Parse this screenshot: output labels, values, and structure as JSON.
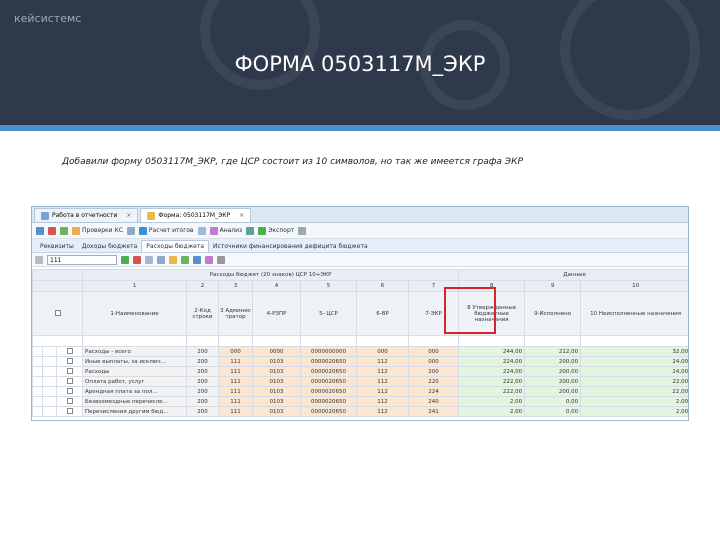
{
  "slide": {
    "logo": "кейсистемс",
    "title": "ФОРМА 0503117М_ЭКР",
    "caption": "Добавили форму 0503117М_ЭКР, где ЦСР состоит из 10 символов, но так же имеется графа ЭКР"
  },
  "app": {
    "tabs": [
      {
        "label": "Работа в отчетности",
        "close": "×"
      },
      {
        "label": "Форма: 0503117М_ЭКР",
        "close": "×"
      }
    ],
    "toolbar": [
      "Проверки КС",
      "Расчет итогов",
      "Анализ",
      "Экспорт"
    ],
    "subtabs": [
      "Реквизиты",
      "Доходы бюджета",
      "Расходы бюджета",
      "Источники финансирования дефицита бюджета"
    ],
    "filter_value": "111",
    "columns_top": {
      "left": "Расходы бюджет (20 знаков) ЦСР 10+ЭКР",
      "right": "Данные"
    },
    "columns": [
      "1-Наименование",
      "2-Код строки",
      "3 Админис тратор",
      "4-РЗПР",
      "5- ЦСР",
      "6-ВР",
      "7-ЭКР",
      "8 Утвержденные бюджетные назначения",
      "9-Исполнено",
      "10 Неисполненные назначения"
    ],
    "col_numbers": [
      "1",
      "2",
      "3",
      "4",
      "5",
      "6",
      "7",
      "8",
      "9",
      "10"
    ],
    "rows": [
      {
        "name": "Расходы - всего",
        "code": "200",
        "adm": "000",
        "rzpr": "0000",
        "csr": "0000000000",
        "vr": "000",
        "ekr": "000",
        "plan": "244,00",
        "done": "212,00",
        "rest": "32,00"
      },
      {
        "name": "Иные выплаты, за исключ...",
        "code": "200",
        "adm": "111",
        "rzpr": "0103",
        "csr": "0000020650",
        "vr": "112",
        "ekr": "000",
        "plan": "224,00",
        "done": "200,00",
        "rest": "24,00"
      },
      {
        "name": "Расходы",
        "code": "200",
        "adm": "111",
        "rzpr": "0103",
        "csr": "0000020650",
        "vr": "112",
        "ekr": "200",
        "plan": "224,00",
        "done": "200,00",
        "rest": "24,00"
      },
      {
        "name": "Оплата работ, услуг",
        "code": "200",
        "adm": "111",
        "rzpr": "0103",
        "csr": "0000020650",
        "vr": "112",
        "ekr": "220",
        "plan": "222,00",
        "done": "200,00",
        "rest": "22,00"
      },
      {
        "name": "Арендная плата за пол...",
        "code": "200",
        "adm": "111",
        "rzpr": "0103",
        "csr": "0000020650",
        "vr": "112",
        "ekr": "224",
        "plan": "222,00",
        "done": "200,00",
        "rest": "22,00"
      },
      {
        "name": "Безвозмездные перечисле...",
        "code": "200",
        "adm": "111",
        "rzpr": "0103",
        "csr": "0000020650",
        "vr": "112",
        "ekr": "240",
        "plan": "2,00",
        "done": "0,00",
        "rest": "2,00"
      },
      {
        "name": "Перечисления другим бюд...",
        "code": "200",
        "adm": "111",
        "rzpr": "0103",
        "csr": "0000020650",
        "vr": "112",
        "ekr": "241",
        "plan": "2,00",
        "done": "0,00",
        "rest": "2,00"
      }
    ]
  }
}
